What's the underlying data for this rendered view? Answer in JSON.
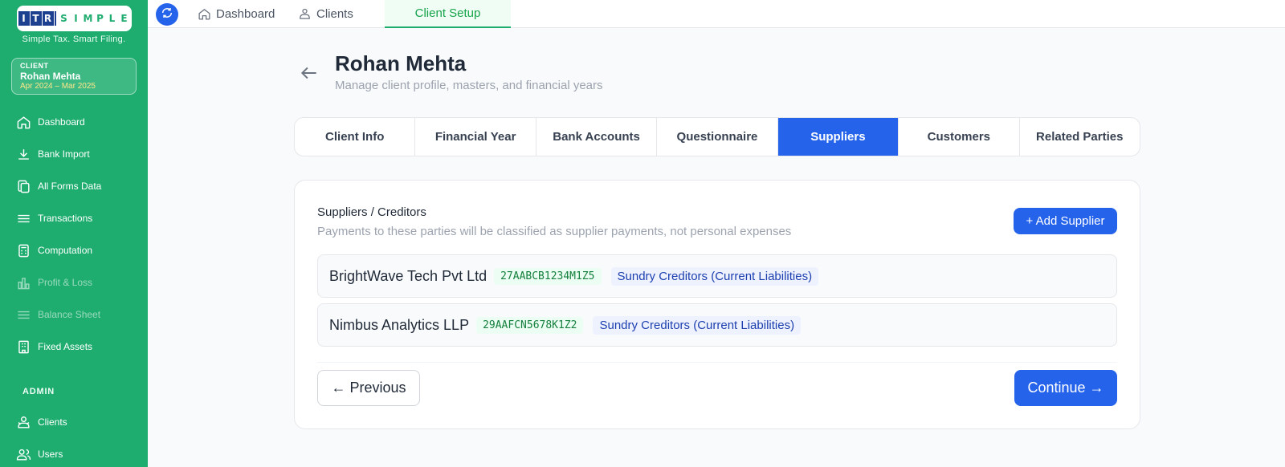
{
  "brand": {
    "logo_letters": [
      "I",
      "T",
      "R",
      "S",
      "I",
      "M",
      "P",
      "L",
      "E"
    ],
    "tagline": "Simple Tax. Smart Filing."
  },
  "client_card": {
    "label": "CLIENT",
    "name": "Rohan Mehta",
    "period": "Apr 2024 – Mar 2025"
  },
  "sidebar": {
    "items": [
      {
        "label": "Dashboard",
        "icon": "home-icon"
      },
      {
        "label": "Bank Import",
        "icon": "download-icon"
      },
      {
        "label": "All Forms Data",
        "icon": "copy-icon"
      },
      {
        "label": "Transactions",
        "icon": "list-icon"
      },
      {
        "label": "Computation",
        "icon": "calculator-icon"
      },
      {
        "label": "Profit & Loss",
        "icon": "bar-chart-icon",
        "disabled": true
      },
      {
        "label": "Balance Sheet",
        "icon": "list-icon",
        "disabled": true
      },
      {
        "label": "Fixed Assets",
        "icon": "building-icon"
      }
    ],
    "admin_label": "ADMIN",
    "admin_items": [
      {
        "label": "Clients",
        "icon": "clients-icon"
      },
      {
        "label": "Users",
        "icon": "users-icon"
      }
    ]
  },
  "topbar": {
    "tabs": [
      {
        "label": "Dashboard",
        "icon": "home-icon"
      },
      {
        "label": "Clients",
        "icon": "clients-icon"
      },
      {
        "label": "Client Setup",
        "active": true
      }
    ]
  },
  "header": {
    "title": "Rohan Mehta",
    "subtitle": "Manage client profile, masters, and financial years"
  },
  "tabs": [
    {
      "label": "Client Info"
    },
    {
      "label": "Financial Year"
    },
    {
      "label": "Bank Accounts"
    },
    {
      "label": "Questionnaire"
    },
    {
      "label": "Suppliers",
      "active": true
    },
    {
      "label": "Customers"
    },
    {
      "label": "Related Parties"
    }
  ],
  "suppliers": {
    "title": "Suppliers / Creditors",
    "subtitle": "Payments to these parties will be classified as supplier payments, not personal expenses",
    "add_label": "+ Add Supplier",
    "rows": [
      {
        "name": "BrightWave Tech Pvt Ltd",
        "gstin": "27AABCB1234M1Z5",
        "group": "Sundry Creditors (Current Liabilities)"
      },
      {
        "name": "Nimbus Analytics LLP",
        "gstin": "29AAFCN5678K1Z2",
        "group": "Sundry Creditors (Current Liabilities)"
      }
    ]
  },
  "footer": {
    "previous_label": "← Previous",
    "continue_label": "Continue →"
  },
  "colors": {
    "sidebar_green": "#1ead6f",
    "primary_blue": "#2563eb"
  }
}
